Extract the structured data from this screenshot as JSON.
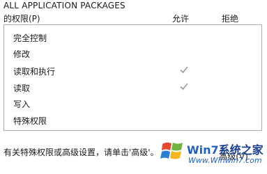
{
  "group_name": "ALL APPLICATION PACKAGES",
  "permissions_header": "的权限(P)",
  "columns": {
    "allow": "允许",
    "deny": "拒绝"
  },
  "permissions": [
    {
      "label": "完全控制",
      "allow": false,
      "deny": false
    },
    {
      "label": "修改",
      "allow": false,
      "deny": false
    },
    {
      "label": "读取和执行",
      "allow": true,
      "deny": false
    },
    {
      "label": "读取",
      "allow": true,
      "deny": false
    },
    {
      "label": "写入",
      "allow": false,
      "deny": false
    },
    {
      "label": "特殊权限",
      "allow": false,
      "deny": false
    }
  ],
  "footer": {
    "text": "有关特殊权限或高级设置，请单击'高级'。",
    "advanced_button": "高级(V)"
  },
  "watermark": {
    "title_part1": "Win7",
    "title_part2": "系统之家",
    "url": "Www.Winwin7.com"
  },
  "colors": {
    "check": "#9a9a9a",
    "border": "#adadad"
  }
}
